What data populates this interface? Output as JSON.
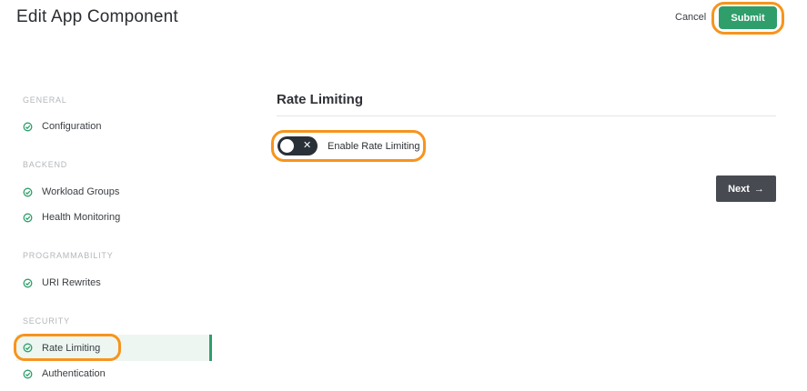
{
  "header": {
    "title": "Edit App Component",
    "cancel_label": "Cancel",
    "submit_label": "Submit"
  },
  "sidebar": {
    "sections": [
      {
        "label": "GENERAL",
        "items": [
          {
            "label": "Configuration",
            "status": "complete"
          }
        ]
      },
      {
        "label": "BACKEND",
        "items": [
          {
            "label": "Workload Groups",
            "status": "complete"
          },
          {
            "label": "Health Monitoring",
            "status": "complete"
          }
        ]
      },
      {
        "label": "PROGRAMMABILITY",
        "items": [
          {
            "label": "URI Rewrites",
            "status": "complete"
          }
        ]
      },
      {
        "label": "SECURITY",
        "items": [
          {
            "label": "Rate Limiting",
            "status": "complete",
            "active": true
          },
          {
            "label": "Authentication",
            "status": "complete"
          }
        ]
      }
    ]
  },
  "main": {
    "section_title": "Rate Limiting",
    "toggle": {
      "label": "Enable Rate Limiting",
      "enabled": false,
      "icon": "x-icon"
    },
    "next_label": "Next",
    "next_icon": "arrow-right-icon"
  },
  "colors": {
    "accent": "#2f9e6b",
    "highlight": "#f7941d",
    "toggle_bg": "#2a3038",
    "next_bg": "#474b51"
  }
}
